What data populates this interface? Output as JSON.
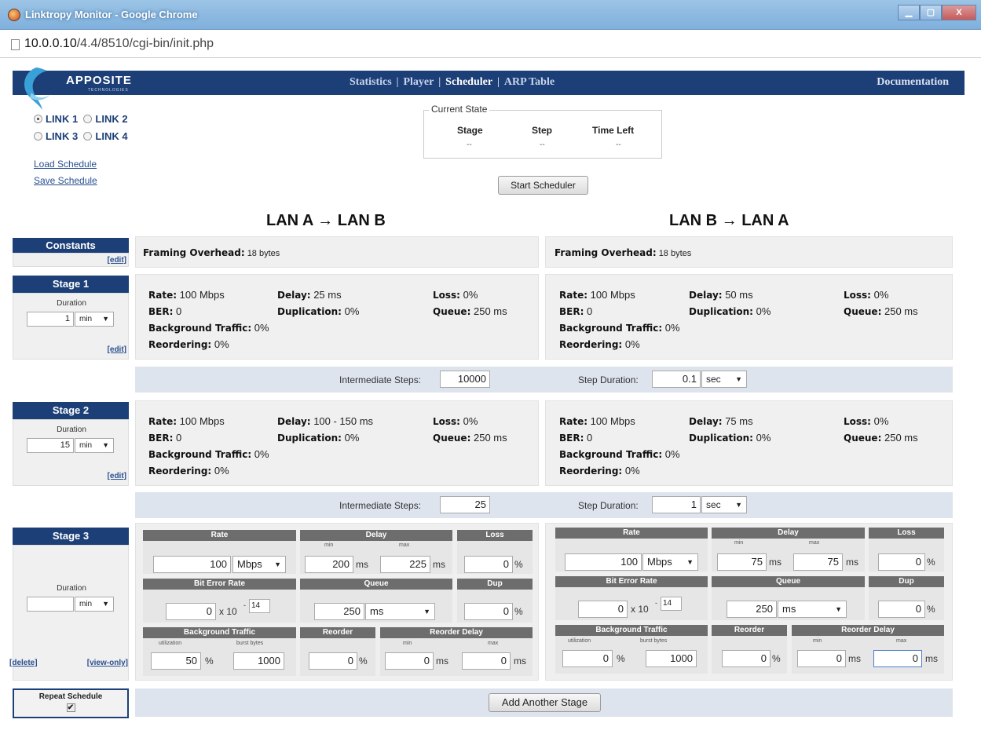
{
  "window": {
    "title": "Linktropy Monitor - Google Chrome",
    "min": "▁",
    "max": "▢",
    "close": "X"
  },
  "address": {
    "host": "10.0.0.10",
    "path": "/4.4/8510/cgi-bin/init.php"
  },
  "logo": {
    "name": "APPOSITE",
    "sub": "TECHNOLOGIES"
  },
  "nav": {
    "items": [
      "Statistics",
      "Player",
      "Scheduler",
      "ARP Table"
    ],
    "sep": "|",
    "documentation": "Documentation"
  },
  "links": {
    "l1": "LINK 1",
    "l2": "LINK 2",
    "l3": "LINK 3",
    "l4": "LINK 4"
  },
  "schedule_links": {
    "load": "Load Schedule",
    "save": "Save Schedule"
  },
  "current_state": {
    "legend": "Current State",
    "headers": [
      "Stage",
      "Step",
      "Time Left"
    ],
    "values": [
      "--",
      "--",
      "--"
    ]
  },
  "start_button": "Start Scheduler",
  "directions": {
    "left": "LAN A → LAN B",
    "right": "LAN B → LAN A"
  },
  "common": {
    "edit": "[edit]",
    "duration": "Duration",
    "min": "min",
    "sec": "sec",
    "ms": "ms",
    "mbps": "Mbps",
    "pct": "%",
    "x10": "x 10",
    "minus": "-",
    "intermediate": "Intermediate Steps:",
    "step_duration": "Step Duration:"
  },
  "constants": {
    "title": "Constants",
    "framing_label": "Framing Overhead:",
    "left": "18 bytes",
    "right": "18 bytes"
  },
  "labels": {
    "rate": "Rate:",
    "delay": "Delay:",
    "loss": "Loss:",
    "ber": "BER:",
    "dup": "Duplication:",
    "queue": "Queue:",
    "bg": "Background Traffic:",
    "reorder": "Reordering:"
  },
  "stage1": {
    "title": "Stage 1",
    "duration": "1",
    "left": {
      "rate": "100 Mbps",
      "delay": "25 ms",
      "loss": "0%",
      "ber": "0",
      "dup": "0%",
      "queue": "250 ms",
      "bg": "0%",
      "reorder": "0%"
    },
    "right": {
      "rate": "100 Mbps",
      "delay": "50 ms",
      "loss": "0%",
      "ber": "0",
      "dup": "0%",
      "queue": "250 ms",
      "bg": "0%",
      "reorder": "0%"
    },
    "steps": "10000",
    "step_duration": "0.1"
  },
  "stage2": {
    "title": "Stage 2",
    "duration": "15",
    "left": {
      "rate": "100 Mbps",
      "delay": "100 - 150 ms",
      "loss": "0%",
      "ber": "0",
      "dup": "0%",
      "queue": "250 ms",
      "bg": "0%",
      "reorder": "0%"
    },
    "right": {
      "rate": "100 Mbps",
      "delay": "75 ms",
      "loss": "0%",
      "ber": "0",
      "dup": "0%",
      "queue": "250 ms",
      "bg": "0%",
      "reorder": "0%"
    },
    "steps": "25",
    "step_duration": "1"
  },
  "stage3": {
    "title": "Stage 3",
    "duration": "",
    "delete": "[delete]",
    "viewonly": "[view-only]",
    "heads": {
      "rate": "Rate",
      "delay": "Delay",
      "loss": "Loss",
      "ber": "Bit Error Rate",
      "queue": "Queue",
      "dup": "Dup",
      "bg": "Background Traffic",
      "reorder": "Reorder",
      "reorder_delay": "Reorder Delay",
      "min": "min",
      "max": "max",
      "util": "utilization",
      "burst": "burst bytes"
    },
    "left": {
      "rate": "100",
      "delay_min": "200",
      "delay_max": "225",
      "loss": "0",
      "ber": "0",
      "ber_exp": "14",
      "queue": "250",
      "dup": "0",
      "util": "50",
      "burst": "1000",
      "reorder": "0",
      "rd_min": "0",
      "rd_max": "0"
    },
    "right": {
      "rate": "100",
      "delay_min": "75",
      "delay_max": "75",
      "loss": "0",
      "ber": "0",
      "ber_exp": "14",
      "queue": "250",
      "dup": "0",
      "util": "0",
      "burst": "1000",
      "reorder": "0",
      "rd_min": "0",
      "rd_max": "0"
    }
  },
  "repeat": {
    "label": "Repeat Schedule",
    "check": "✔"
  },
  "add_stage": "Add Another Stage"
}
